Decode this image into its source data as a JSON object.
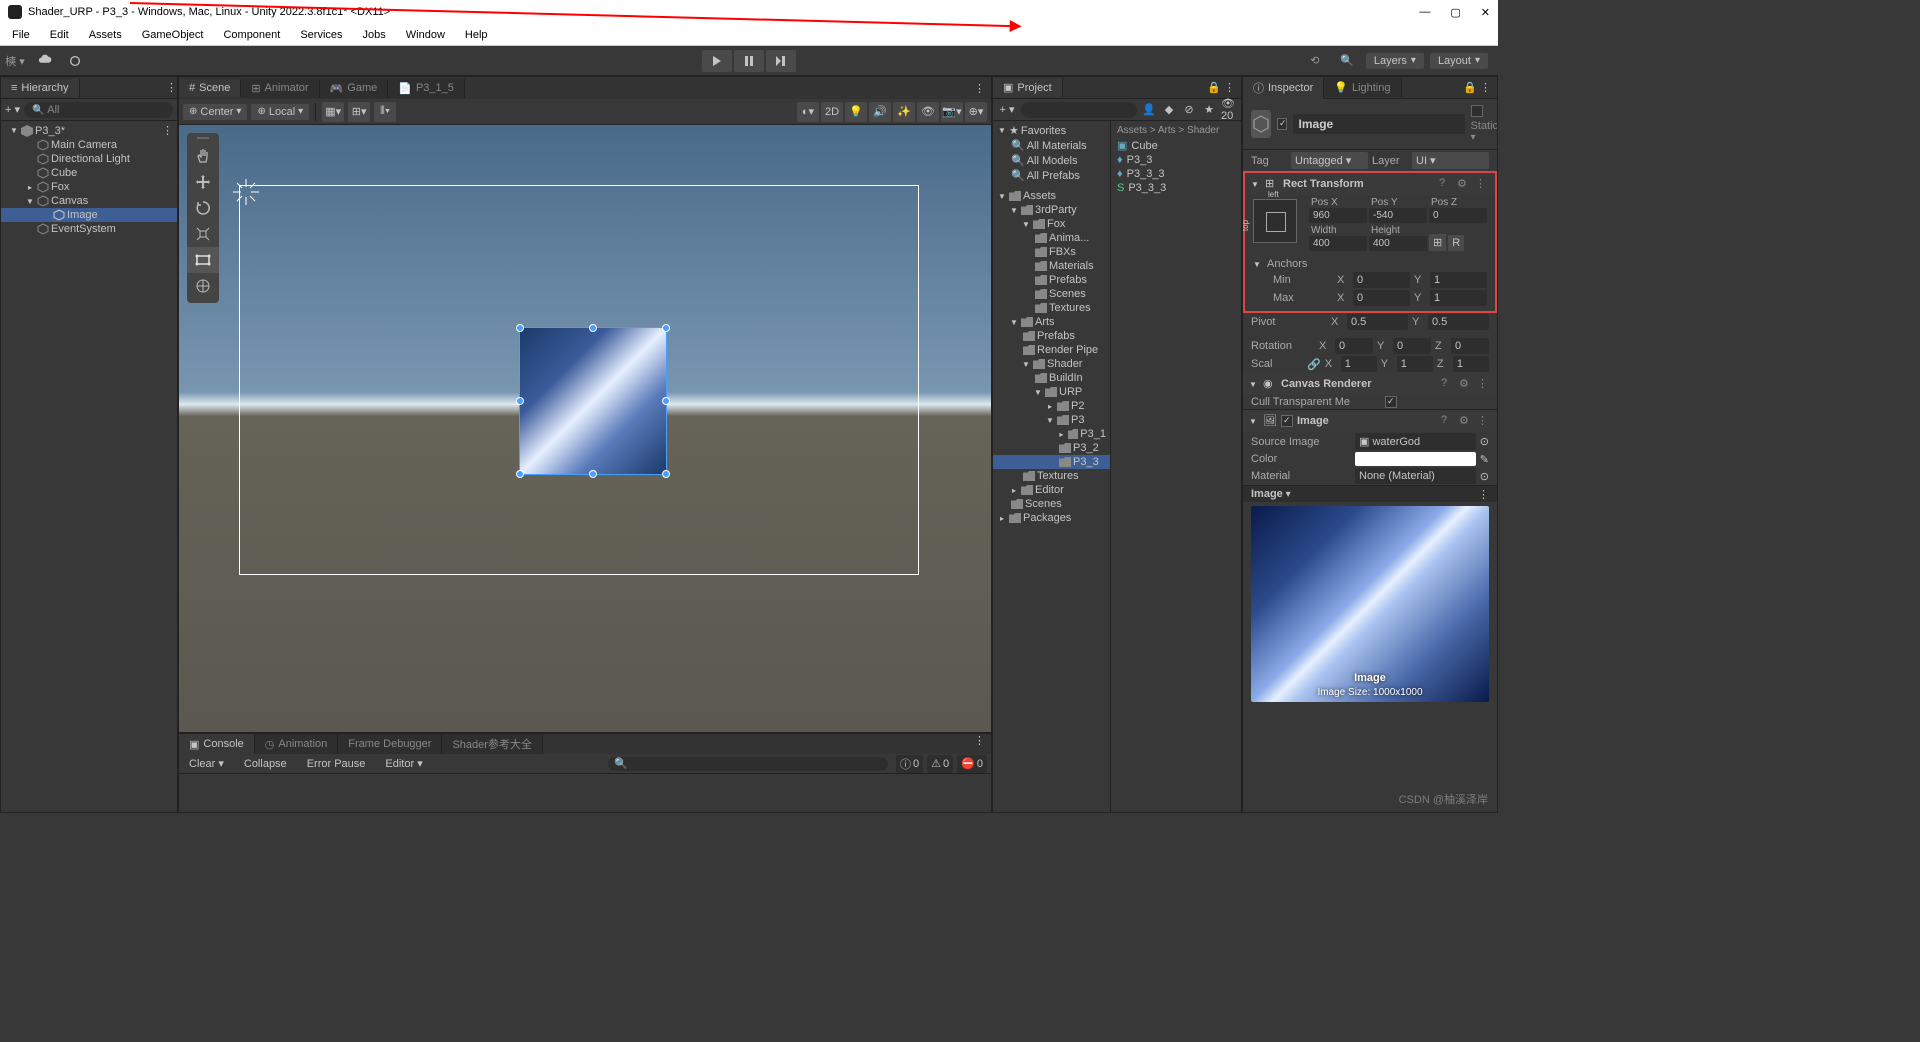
{
  "window": {
    "title": "Shader_URP - P3_3 - Windows, Mac, Linux - Unity 2022.3.8f1c1* <DX11>",
    "minimize": "—",
    "maximize": "▢",
    "close": "✕"
  },
  "menu": [
    "File",
    "Edit",
    "Assets",
    "GameObject",
    "Component",
    "Services",
    "Jobs",
    "Window",
    "Help"
  ],
  "toolbar": {
    "account": "樉 ▾",
    "layers": "Layers",
    "layout": "Layout"
  },
  "hierarchy": {
    "title": "Hierarchy",
    "search": "All",
    "root": "P3_3*",
    "items": [
      "Main Camera",
      "Directional Light",
      "Cube",
      "Fox",
      "Canvas",
      "Image",
      "EventSystem"
    ]
  },
  "sceneTabs": {
    "scene": "Scene",
    "animator": "Animator",
    "game": "Game",
    "asset": "P3_1_5"
  },
  "sceneTool": {
    "center": "Center",
    "local": "Local",
    "twod": "2D"
  },
  "project": {
    "title": "Project",
    "favorites": "Favorites",
    "allmat": "All Materials",
    "allmod": "All Models",
    "allpre": "All Prefabs",
    "assets": "Assets",
    "thirdparty": "3rdParty",
    "fox": "Fox",
    "anim": "Anima...",
    "fbxs": "FBXs",
    "materials": "Materials",
    "prefabs": "Prefabs",
    "scenes": "Scenes",
    "textures": "Textures",
    "arts": "Arts",
    "prefabs2": "Prefabs",
    "renderpipe": "Render Pipe",
    "shader": "Shader",
    "buildin": "BuildIn",
    "urp": "URP",
    "p2": "P2",
    "p3": "P3",
    "p31": "P3_1",
    "p32": "P3_2",
    "p33": "P3_3",
    "textures2": "Textures",
    "editor": "Editor",
    "scenes2": "Scenes",
    "packages": "Packages",
    "crumb": "Assets > Arts > Shader",
    "content": [
      "Cube",
      "P3_3",
      "P3_3_3",
      "P3_3_3"
    ]
  },
  "inspector": {
    "title": "Inspector",
    "lighting": "Lighting",
    "name": "Image",
    "static": "Static",
    "tag": "Tag",
    "tagval": "Untagged",
    "layer": "Layer",
    "layerval": "UI",
    "rect": {
      "title": "Rect Transform",
      "left": "left",
      "top": "top",
      "posx": "Pos X",
      "posy": "Pos Y",
      "posz": "Pos Z",
      "posxv": "960",
      "posyv": "-540",
      "poszv": "0",
      "width": "Width",
      "height": "Height",
      "widthv": "400",
      "heightv": "400",
      "anchors": "Anchors",
      "min": "Min",
      "max": "Max",
      "minx": "0",
      "miny": "1",
      "maxx": "0",
      "maxy": "1",
      "pivot": "Pivot",
      "pivotx": "0.5",
      "pivoty": "0.5",
      "rotation": "Rotation",
      "rotx": "0",
      "roty": "0",
      "rotz": "0",
      "scale": "Scal",
      "scalx": "1",
      "scaly": "1",
      "scalz": "1"
    },
    "canvasRenderer": {
      "title": "Canvas Renderer",
      "cull": "Cull Transparent Me"
    },
    "image": {
      "title": "Image",
      "source": "Source Image",
      "sourcev": "waterGod",
      "color": "Color",
      "material": "Material",
      "materialv": "None (Material)",
      "preview": "Image",
      "size": "Image Size: 1000x1000"
    }
  },
  "console": {
    "tabs": [
      "Console",
      "Animation",
      "Frame Debugger",
      "Shader参考大全"
    ],
    "clear": "Clear",
    "collapse": "Collapse",
    "errorpause": "Error Pause",
    "editor": "Editor",
    "c0": "0",
    "c1": "0",
    "c2": "0"
  },
  "watermark": "CSDN @柚溪泽岸"
}
